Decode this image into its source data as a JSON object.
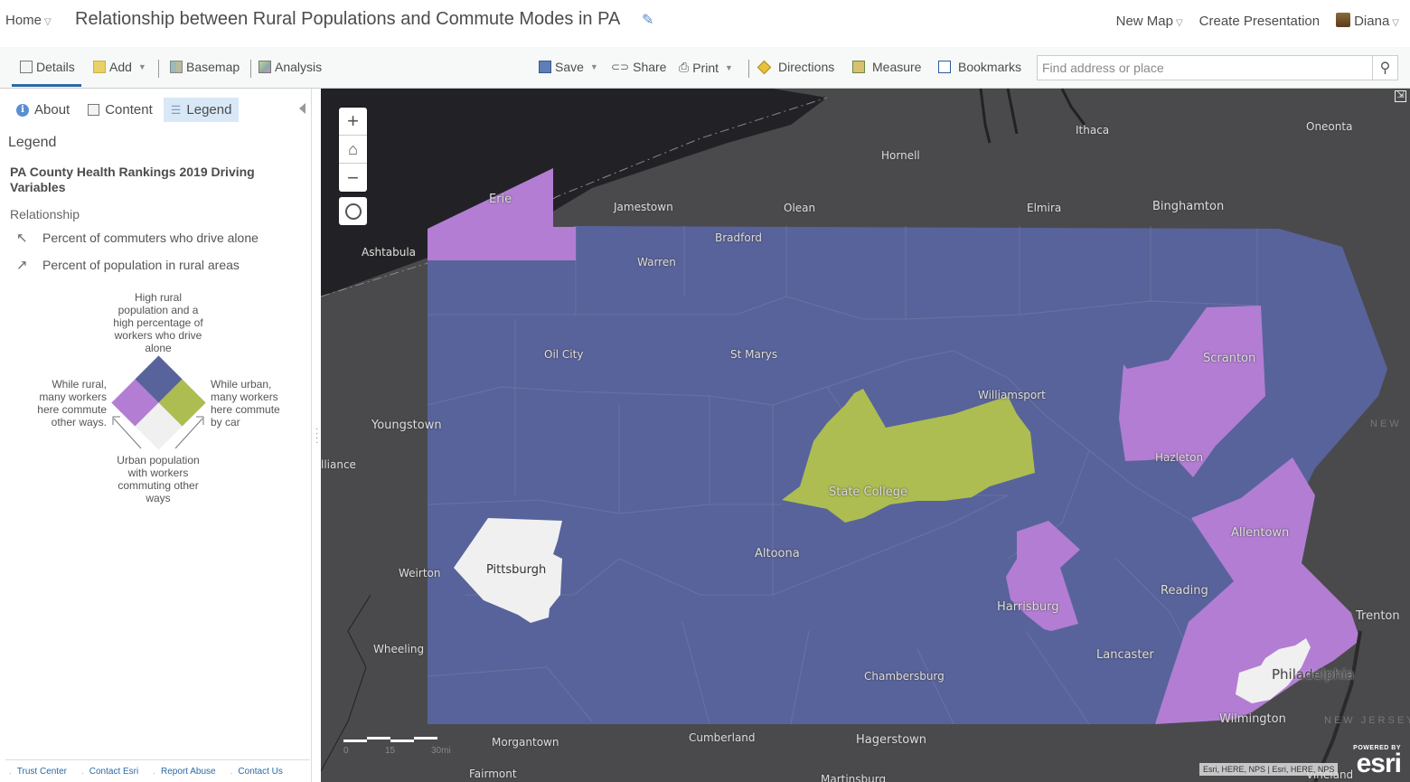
{
  "topbar": {
    "home_label": "Home",
    "map_title": "Relationship between Rural Populations and Commute Modes in PA",
    "new_map_label": "New Map",
    "create_presentation_label": "Create Presentation",
    "user_name": "Diana"
  },
  "toolbar": {
    "details_label": "Details",
    "add_label": "Add",
    "basemap_label": "Basemap",
    "analysis_label": "Analysis",
    "save_label": "Save",
    "share_label": "Share",
    "print_label": "Print",
    "directions_label": "Directions",
    "measure_label": "Measure",
    "bookmarks_label": "Bookmarks",
    "search_placeholder": "Find address or place"
  },
  "sidebar": {
    "tabs": [
      {
        "label": "About",
        "icon": "info-icon"
      },
      {
        "label": "Content",
        "icon": "content-icon"
      },
      {
        "label": "Legend",
        "icon": "legend-icon",
        "active": true
      }
    ],
    "legend_heading": "Legend",
    "layer_title": "PA County Health Rankings 2019 Driving Variables",
    "relationship_heading": "Relationship",
    "axes": [
      {
        "arrow": "↖",
        "label": "Percent of commuters who drive alone"
      },
      {
        "arrow": "↗",
        "label": "Percent of population in rural areas"
      }
    ],
    "legend_labels": {
      "top": "High rural population and a high percentage of workers who drive alone",
      "left": "While rural, many workers here commute other ways.",
      "right": "While urban, many workers here commute by car",
      "bottom": "Urban population with workers commuting other ways"
    },
    "legend_colors": {
      "top": "#58639b",
      "left": "#b37dd4",
      "right": "#adbd51",
      "bottom": "#f0f0f0"
    },
    "footer_links": [
      "Trust Center",
      "Contact Esri",
      "Report Abuse",
      "Contact Us"
    ]
  },
  "map": {
    "colors": {
      "background": "#4a4a4c",
      "water": "#222226",
      "rural_drive_alone": "#58639b",
      "rural_other": "#b37dd4",
      "urban_car": "#adbd51",
      "urban_other": "#f0f0f0"
    },
    "zoom_in_label": "+",
    "zoom_out_label": "−",
    "cities": [
      {
        "name": "Ithaca"
      },
      {
        "name": "Oneonta"
      },
      {
        "name": "Hornell"
      },
      {
        "name": "Erie"
      },
      {
        "name": "Jamestown"
      },
      {
        "name": "Olean"
      },
      {
        "name": "Elmira"
      },
      {
        "name": "Binghamton"
      },
      {
        "name": "Ashtabula"
      },
      {
        "name": "Bradford"
      },
      {
        "name": "Warren"
      },
      {
        "name": "Oil City"
      },
      {
        "name": "St Marys"
      },
      {
        "name": "Scranton"
      },
      {
        "name": "Williamsport"
      },
      {
        "name": "Youngstown"
      },
      {
        "name": "Hazleton"
      },
      {
        "name": "lliance"
      },
      {
        "name": "State College"
      },
      {
        "name": "Allentown"
      },
      {
        "name": "Pittsburgh"
      },
      {
        "name": "Altoona"
      },
      {
        "name": "Weirton"
      },
      {
        "name": "Reading"
      },
      {
        "name": "Harrisburg"
      },
      {
        "name": "Trenton"
      },
      {
        "name": "Wheeling"
      },
      {
        "name": "Lancaster"
      },
      {
        "name": "Philadelphia"
      },
      {
        "name": "Chambersburg"
      },
      {
        "name": "Wilmington"
      },
      {
        "name": "Morgantown"
      },
      {
        "name": "Cumberland"
      },
      {
        "name": "Hagerstown"
      },
      {
        "name": "Fairmont"
      },
      {
        "name": "Martinsburg"
      },
      {
        "name": "Vineland"
      }
    ],
    "state_labels": [
      "NEW JERSEY",
      "NEW"
    ],
    "scale": {
      "ticks": [
        "0",
        "15",
        "30mi"
      ]
    },
    "attribution": "Esri, HERE, NPS | Esri, HERE, NPS",
    "powered_by": "POWERED BY",
    "esri_logo": "esri"
  }
}
